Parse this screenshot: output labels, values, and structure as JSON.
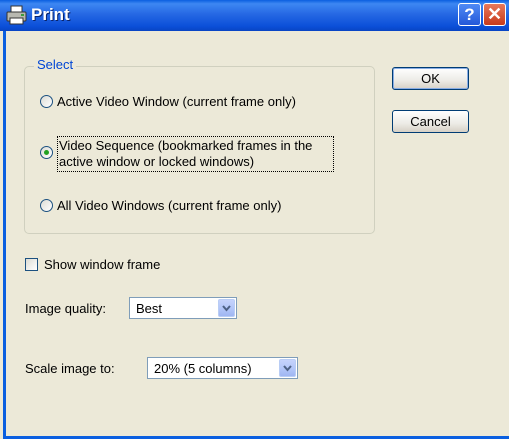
{
  "window": {
    "title": "Print",
    "help_glyph": "?",
    "close_glyph": "✕",
    "title_icon": "printer-icon"
  },
  "select_group": {
    "label": "Select",
    "options": [
      {
        "label": "Active Video Window (current frame only)",
        "selected": false
      },
      {
        "label": "Video Sequence (bookmarked frames in the active window or locked windows)",
        "selected": true
      },
      {
        "label": "All Video Windows (current frame only)",
        "selected": false
      }
    ]
  },
  "buttons": {
    "ok": "OK",
    "cancel": "Cancel"
  },
  "show_window_frame": {
    "label": "Show window frame",
    "checked": false
  },
  "image_quality": {
    "label": "Image quality:",
    "value": "Best"
  },
  "scale_image": {
    "label": "Scale image to:",
    "value": "20% (5 columns)"
  },
  "colors": {
    "titlebar": "#0a5fe0",
    "dialog_bg": "#ece9d8",
    "group_label": "#0046d5",
    "selected_radio": "#21a121"
  }
}
